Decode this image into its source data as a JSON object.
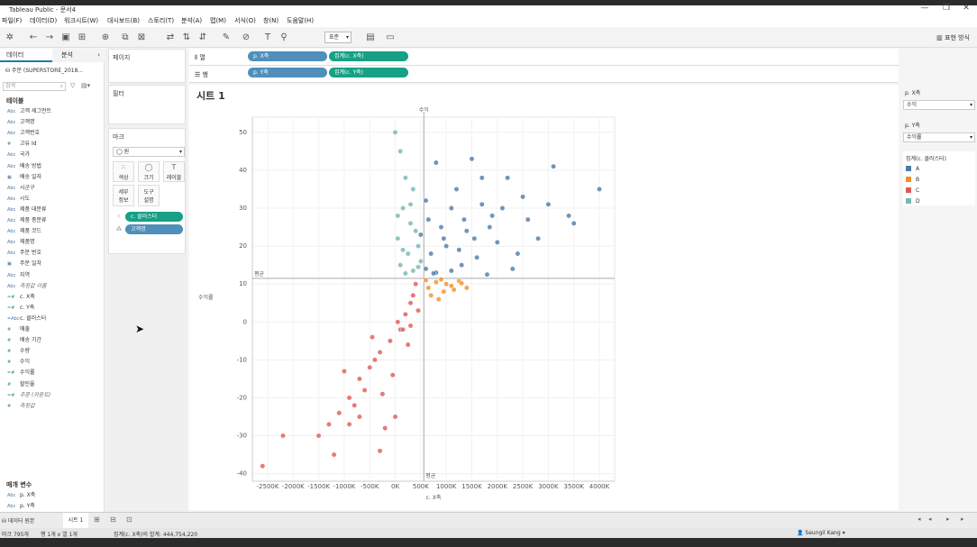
{
  "window": {
    "title": "Tableau Public - 문서4"
  },
  "menu": [
    "파일(F)",
    "데이터(D)",
    "워크시트(W)",
    "대시보드(B)",
    "스토리(T)",
    "분석(A)",
    "맵(M)",
    "서식(O)",
    "창(N)",
    "도움말(H)"
  ],
  "toolbar": {
    "fit_value": "표준",
    "show_me": "표현 방식"
  },
  "data_pane": {
    "tab_data": "데이터",
    "tab_analysis": "분석",
    "datasource": "주문 (SUPERSTORE_2018...",
    "search_placeholder": "검색",
    "tables_header": "테이블",
    "fields": [
      {
        "icon": "Abc",
        "name": "고객 세그먼트"
      },
      {
        "icon": "Abc",
        "name": "고객명"
      },
      {
        "icon": "Abc",
        "name": "고객번호"
      },
      {
        "icon": "#",
        "name": "고유 Id"
      },
      {
        "icon": "Abc",
        "name": "국가"
      },
      {
        "icon": "Abc",
        "name": "배송 방법"
      },
      {
        "icon": "▣",
        "name": "배송 일자"
      },
      {
        "icon": "Abc",
        "name": "시군구"
      },
      {
        "icon": "Abc",
        "name": "시도"
      },
      {
        "icon": "Abc",
        "name": "제품 대분류"
      },
      {
        "icon": "Abc",
        "name": "제품 중분류"
      },
      {
        "icon": "Abc",
        "name": "제품 코드"
      },
      {
        "icon": "Abc",
        "name": "제품명"
      },
      {
        "icon": "Abc",
        "name": "주문 번호"
      },
      {
        "icon": "▣",
        "name": "주문 일자"
      },
      {
        "icon": "Abc",
        "name": "지역"
      },
      {
        "icon": "Abc",
        "name": "측정값 이름",
        "italic": true
      },
      {
        "icon": "=#",
        "name": "c. X축"
      },
      {
        "icon": "=#",
        "name": "c. Y축"
      },
      {
        "icon": "=Abc",
        "name": "c. 클러스터"
      },
      {
        "icon": "#",
        "name": "매출"
      },
      {
        "icon": "#",
        "name": "배송 기간"
      },
      {
        "icon": "#",
        "name": "수량"
      },
      {
        "icon": "#",
        "name": "수익"
      },
      {
        "icon": "=#",
        "name": "수익률"
      },
      {
        "icon": "#",
        "name": "할인율"
      },
      {
        "icon": "=#",
        "name": "주문 (카운트)",
        "italic": true
      },
      {
        "icon": "#",
        "name": "측정값",
        "italic": true
      }
    ],
    "params_header": "매개 변수",
    "params": [
      {
        "icon": "Abc",
        "name": "p. X축"
      },
      {
        "icon": "Abc",
        "name": "p. Y축"
      }
    ]
  },
  "cards": {
    "pages": "페이지",
    "filters": "필터",
    "marks": "마크",
    "mark_type": "원",
    "buttons": [
      {
        "label": "색상",
        "icon": "⁙"
      },
      {
        "label": "크기",
        "icon": "◯"
      },
      {
        "label": "레이블",
        "icon": "T"
      },
      {
        "label": "세부\n정보",
        "icon": ""
      },
      {
        "label": "도구\n설명",
        "icon": ""
      }
    ],
    "mark_pills": [
      "c. 클러스터",
      "고객명"
    ]
  },
  "shelves": {
    "columns_label": "열",
    "rows_label": "행",
    "columns_pills": [
      "p. X축",
      "집계(c. X축)"
    ],
    "rows_pills": [
      "p. Y축",
      "집계(c. Y축)"
    ]
  },
  "sheet": {
    "title": "시트 1",
    "top_axis_label": "수익",
    "avg_label_left": "평균",
    "avg_label_bottom": "평균"
  },
  "right_panel": {
    "px_label": "p. X축",
    "px_value": "수익",
    "py_label": "p. Y축",
    "py_value": "수익률",
    "legend_title": "집계(c. 클러스터)",
    "legend": [
      {
        "label": "A",
        "color": "#4e79a7"
      },
      {
        "label": "B",
        "color": "#f28e2b"
      },
      {
        "label": "C",
        "color": "#e15759"
      },
      {
        "label": "D",
        "color": "#76b7b2"
      }
    ]
  },
  "bottom": {
    "datasource_tab": "데이터 원본",
    "sheet_tab": "시트 1",
    "status_marks": "마크 795개",
    "status_rowcol": "행 1개 x 열 1개",
    "status_sum": "집계(c. X축)의 합계: 444,754,220",
    "user": "Seungil Kang"
  },
  "chart_data": {
    "type": "scatter",
    "xlabel": "c. X축",
    "ylabel": "수익률",
    "xticks": [
      "-2500K",
      "-2000K",
      "-1500K",
      "-1000K",
      "-500K",
      "0K",
      "500K",
      "1000K",
      "1500K",
      "2000K",
      "2500K",
      "3000K",
      "3500K",
      "4000K"
    ],
    "yticks": [
      50,
      40,
      30,
      20,
      10,
      0,
      -10,
      -20,
      -30,
      -40
    ],
    "xlim": [
      -2800000,
      4300000
    ],
    "ylim": [
      -42,
      54
    ],
    "avg_x": 560000,
    "avg_y": 11.5,
    "series": [
      {
        "cluster": "A",
        "color": "#4e79a7",
        "points": [
          [
            800000,
            42
          ],
          [
            1500000,
            43
          ],
          [
            2200000,
            38
          ],
          [
            3100000,
            41
          ],
          [
            4000000,
            35
          ],
          [
            1200000,
            35
          ],
          [
            1700000,
            38
          ],
          [
            2500000,
            33
          ],
          [
            3400000,
            28
          ],
          [
            2800000,
            22
          ],
          [
            1900000,
            28
          ],
          [
            1100000,
            30
          ],
          [
            900000,
            25
          ],
          [
            1400000,
            24
          ],
          [
            2000000,
            21
          ],
          [
            2600000,
            27
          ],
          [
            3000000,
            31
          ],
          [
            600000,
            32
          ],
          [
            700000,
            18
          ],
          [
            1000000,
            20
          ],
          [
            1300000,
            15
          ],
          [
            1600000,
            17
          ],
          [
            2300000,
            14
          ],
          [
            1800000,
            12.5
          ],
          [
            2400000,
            18
          ],
          [
            600000,
            14
          ],
          [
            800000,
            13
          ],
          [
            1100000,
            13.5
          ],
          [
            500000,
            23
          ],
          [
            650000,
            27
          ],
          [
            950000,
            22
          ],
          [
            1250000,
            19
          ],
          [
            1550000,
            22
          ],
          [
            1850000,
            25
          ],
          [
            2100000,
            30
          ],
          [
            3500000,
            26
          ],
          [
            1700000,
            31
          ],
          [
            1350000,
            27
          ],
          [
            750000,
            12.8
          ]
        ]
      },
      {
        "cluster": "B",
        "color": "#f28e2b",
        "points": [
          [
            650000,
            9
          ],
          [
            800000,
            10.5
          ],
          [
            950000,
            8
          ],
          [
            1100000,
            9.5
          ],
          [
            1250000,
            10.8
          ],
          [
            1400000,
            9
          ],
          [
            700000,
            7
          ],
          [
            850000,
            6
          ],
          [
            1000000,
            10
          ],
          [
            1150000,
            8.5
          ],
          [
            600000,
            11
          ],
          [
            900000,
            11.2
          ],
          [
            1300000,
            10.2
          ]
        ]
      },
      {
        "cluster": "C",
        "color": "#e15759",
        "points": [
          [
            400000,
            10
          ],
          [
            300000,
            5
          ],
          [
            200000,
            2
          ],
          [
            100000,
            -2
          ],
          [
            -100000,
            -5
          ],
          [
            -300000,
            -8
          ],
          [
            -500000,
            -12
          ],
          [
            -700000,
            -15
          ],
          [
            -900000,
            -20
          ],
          [
            -1100000,
            -24
          ],
          [
            -1300000,
            -27
          ],
          [
            -1500000,
            -30
          ],
          [
            -2200000,
            -30
          ],
          [
            -2600000,
            -38
          ],
          [
            -1200000,
            -35
          ],
          [
            -800000,
            -22
          ],
          [
            -600000,
            -18
          ],
          [
            -400000,
            -10
          ],
          [
            -200000,
            -28
          ],
          [
            0,
            -25
          ],
          [
            -700000,
            -25
          ],
          [
            -300000,
            -34
          ],
          [
            150000,
            -2
          ],
          [
            350000,
            7
          ],
          [
            450000,
            3
          ],
          [
            250000,
            -6
          ],
          [
            -50000,
            -14
          ],
          [
            -250000,
            -19
          ],
          [
            -450000,
            -4
          ],
          [
            50000,
            0
          ],
          [
            300000,
            -1
          ],
          [
            -900000,
            -27
          ],
          [
            -1000000,
            -13
          ]
        ]
      },
      {
        "cluster": "D",
        "color": "#76b7b2",
        "points": [
          [
            0,
            50
          ],
          [
            100000,
            45
          ],
          [
            200000,
            38
          ],
          [
            350000,
            35
          ],
          [
            150000,
            30
          ],
          [
            300000,
            26
          ],
          [
            50000,
            22
          ],
          [
            250000,
            18
          ],
          [
            450000,
            20
          ],
          [
            100000,
            15
          ],
          [
            350000,
            13.5
          ],
          [
            500000,
            16
          ],
          [
            200000,
            12.8
          ],
          [
            400000,
            24
          ],
          [
            50000,
            28
          ],
          [
            300000,
            31
          ],
          [
            150000,
            19
          ],
          [
            450000,
            14.5
          ]
        ]
      }
    ]
  }
}
